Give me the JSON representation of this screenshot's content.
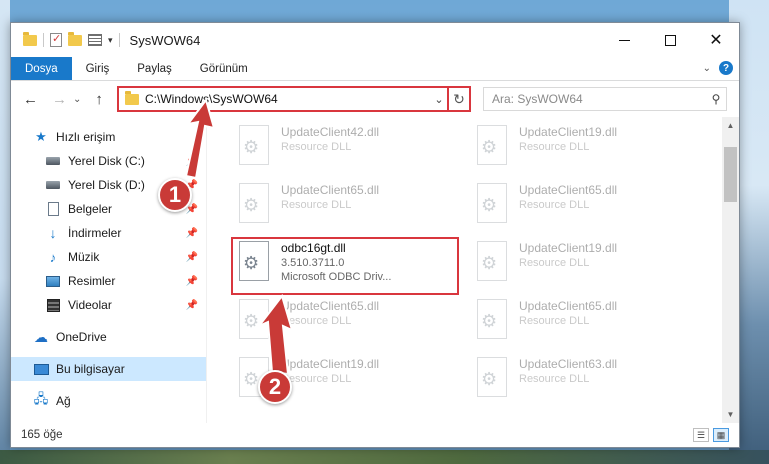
{
  "window": {
    "title": "SysWOW64",
    "controls": {
      "minimize": "",
      "maximize": "",
      "close": "✕"
    }
  },
  "ribbon": {
    "tabs": [
      "Dosya",
      "Giriş",
      "Paylaş",
      "Görünüm"
    ],
    "help": "?"
  },
  "address": {
    "path": "C:\\Windows\\SysWOW64",
    "search_placeholder": "Ara: SysWOW64"
  },
  "sidebar": {
    "quick_access": "Hızlı erişim",
    "items": [
      {
        "label": "Yerel Disk (C:)",
        "icon": "drive-icon"
      },
      {
        "label": "Yerel Disk (D:)",
        "icon": "drive-icon"
      },
      {
        "label": "Belgeler",
        "icon": "documents-icon"
      },
      {
        "label": "İndirmeler",
        "icon": "download-icon"
      },
      {
        "label": "Müzik",
        "icon": "music-icon"
      },
      {
        "label": "Resimler",
        "icon": "pictures-icon"
      },
      {
        "label": "Videolar",
        "icon": "videos-icon"
      }
    ],
    "onedrive": "OneDrive",
    "this_pc": "Bu bilgisayar",
    "network": "Ağ"
  },
  "files": [
    {
      "name": "UpdateClient42.dll",
      "desc": "Resource DLL"
    },
    {
      "name": "UpdateClient19.dll",
      "desc": "Resource DLL"
    },
    {
      "name": "UpdateClient65.dll",
      "desc": "Resource DLL"
    },
    {
      "name": "UpdateClient65.dll",
      "desc": "Resource DLL"
    },
    {
      "name": "odbc16gt.dll",
      "version": "3.510.3711.0",
      "desc": "Microsoft ODBC Driv..."
    },
    {
      "name": "UpdateClient19.dll",
      "desc": "Resource DLL"
    },
    {
      "name": "UpdateClient65.dll",
      "desc": "Resource DLL"
    },
    {
      "name": "UpdateClient65.dll",
      "desc": "Resource DLL"
    },
    {
      "name": "UpdateClient19.dll",
      "desc": "Resource DLL"
    },
    {
      "name": "UpdateClient63.dll",
      "desc": "Resource DLL"
    }
  ],
  "status": {
    "item_count": "165 öğe"
  },
  "annotations": {
    "step1": "1",
    "step2": "2",
    "accent_color": "#d9363e"
  }
}
